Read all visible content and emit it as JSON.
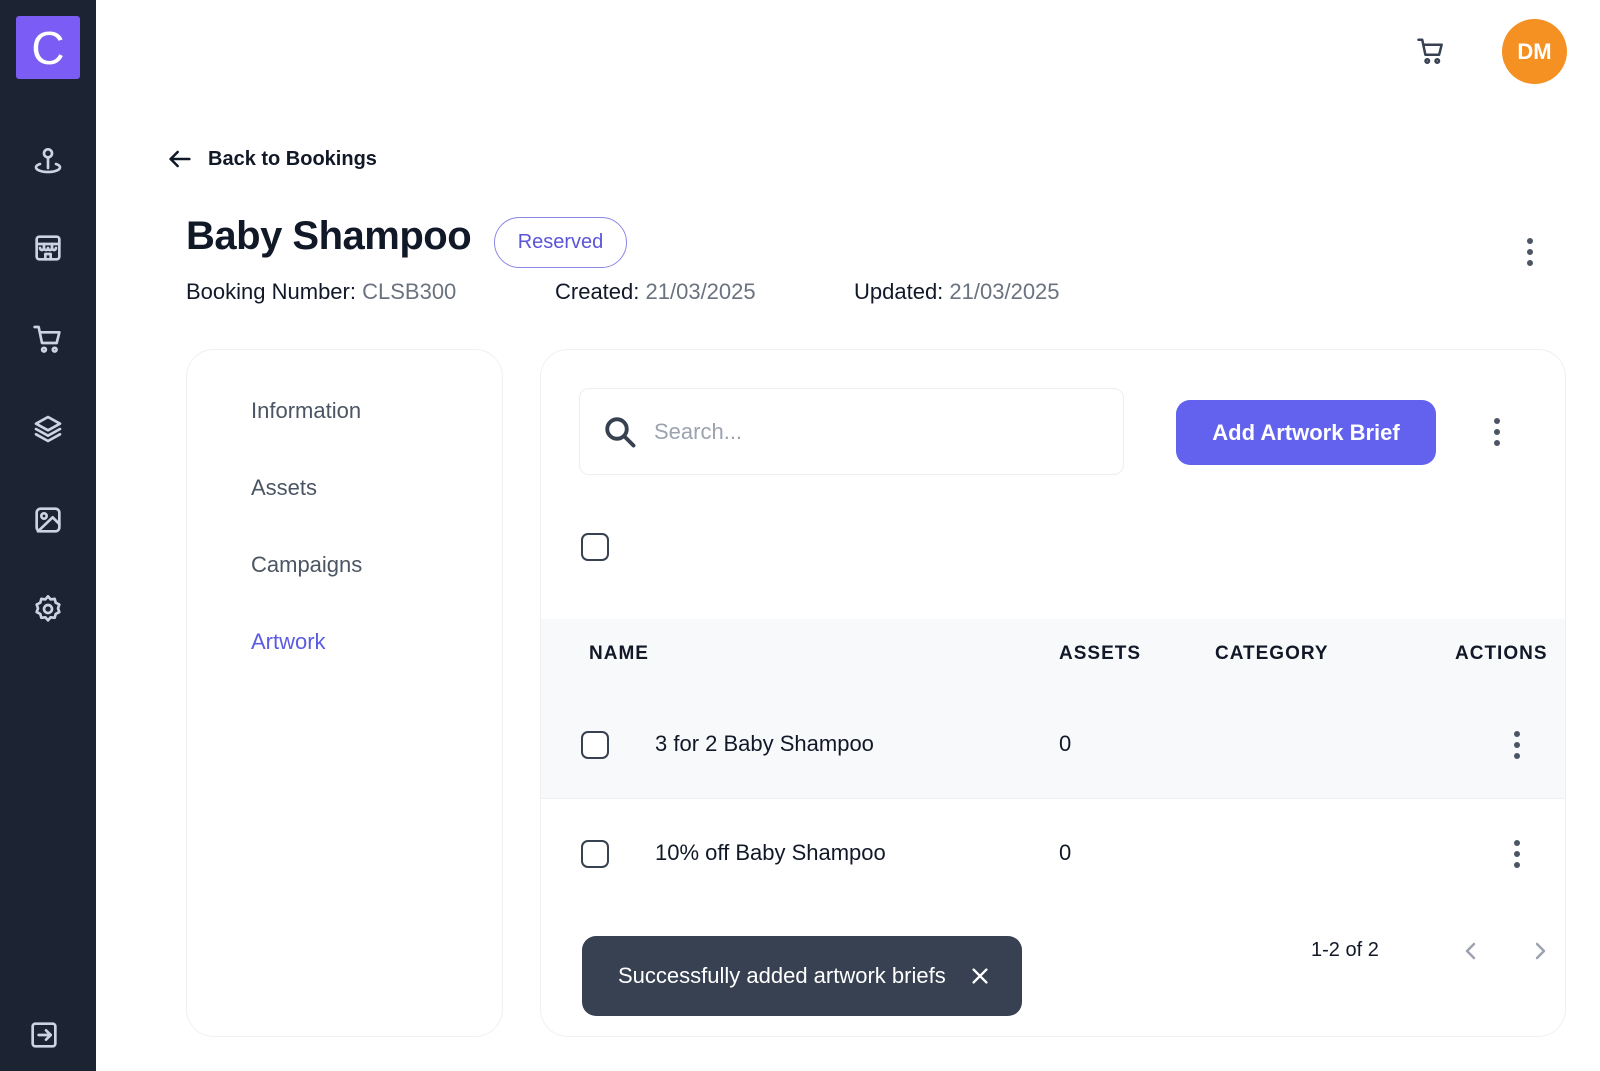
{
  "app": {
    "logo_letter": "C",
    "accent_color": "#6262ee",
    "sidebar_color": "#1c2333"
  },
  "sidebar": {
    "items": [
      {
        "name": "location-pin-icon"
      },
      {
        "name": "store-icon"
      },
      {
        "name": "cart-icon"
      },
      {
        "name": "layers-icon"
      },
      {
        "name": "image-icon"
      },
      {
        "name": "gear-icon"
      },
      {
        "name": "logout-icon"
      }
    ]
  },
  "header": {
    "user_initials": "DM",
    "avatar_color": "#f59023"
  },
  "back_link": {
    "label": "Back to Bookings"
  },
  "booking": {
    "title": "Baby Shampoo",
    "status": "Reserved",
    "booking_number_label": "Booking Number:",
    "booking_number": "CLSB300",
    "created_label": "Created:",
    "created": "21/03/2025",
    "updated_label": "Updated:",
    "updated": "21/03/2025"
  },
  "tabs": [
    {
      "label": "Information",
      "active": false
    },
    {
      "label": "Assets",
      "active": false
    },
    {
      "label": "Campaigns",
      "active": false
    },
    {
      "label": "Artwork",
      "active": true
    }
  ],
  "artwork": {
    "search_placeholder": "Search...",
    "add_button": "Add Artwork Brief",
    "columns": {
      "name": "NAME",
      "assets": "ASSETS",
      "category": "CATEGORY",
      "actions": "ACTIONS"
    },
    "rows": [
      {
        "name": "3 for 2 Baby Shampoo",
        "assets": "0",
        "category": ""
      },
      {
        "name": "10% off Baby Shampoo",
        "assets": "0",
        "category": ""
      }
    ],
    "pagination": "1-2 of 2"
  },
  "toast": {
    "message": "Successfully added artwork briefs"
  }
}
